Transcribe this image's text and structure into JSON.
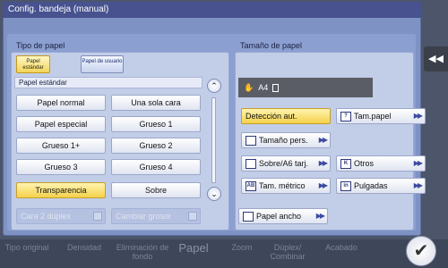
{
  "dialog": {
    "title": "Config. bandeja (manual)"
  },
  "paper_type": {
    "section_label": "Tipo de papel",
    "tabs": [
      {
        "label": "Papel estándar",
        "active": true
      },
      {
        "label": "Papel de usuario",
        "active": false
      }
    ],
    "subheader": "Papel estándar",
    "options": [
      {
        "label": "Papel normal",
        "selected": false
      },
      {
        "label": "Una sola cara",
        "selected": false
      },
      {
        "label": "Papel especial",
        "selected": false
      },
      {
        "label": "Grueso 1",
        "selected": false
      },
      {
        "label": "Grueso 1+",
        "selected": false
      },
      {
        "label": "Grueso 2",
        "selected": false
      },
      {
        "label": "Grueso 3",
        "selected": false
      },
      {
        "label": "Grueso 4",
        "selected": false
      },
      {
        "label": "Transparencia",
        "selected": true
      },
      {
        "label": "Sobre",
        "selected": false
      }
    ],
    "disabled": [
      {
        "label": "Cara 2 dúplex"
      },
      {
        "label": "Cambiar grosor"
      }
    ]
  },
  "paper_size": {
    "section_label": "Tamaño de papel",
    "current": "A4",
    "options": [
      {
        "label": "Detección aut.",
        "selected": true,
        "icon": ""
      },
      {
        "label": "Tam.papel",
        "icon": "?"
      },
      {
        "label": "Tamaño pers.",
        "icon": ""
      },
      {
        "label": "Sobre/A6 tarj.",
        "icon": ""
      },
      {
        "label": "Otros",
        "icon": "K"
      },
      {
        "label": "Tam. métrico",
        "icon": "AB"
      },
      {
        "label": "Pulgadas",
        "icon": "in"
      },
      {
        "label": "Papel ancho",
        "icon": ""
      }
    ]
  },
  "background": {
    "items": [
      "Tipo original",
      "Densidad",
      "Eliminación de fondo",
      "Papel",
      "Zoom",
      "Dúplex/ Combinar",
      "Acabado"
    ]
  }
}
